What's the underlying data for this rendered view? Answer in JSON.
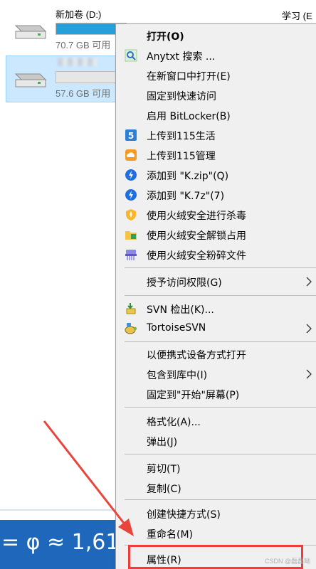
{
  "explorer": {
    "drives": [
      {
        "name": "新加卷 (D:)",
        "free_text": "70.7 GB 可用",
        "usage_fraction": 1.0
      },
      {
        "name": "",
        "free_text": "57.6 GB 可用",
        "usage_fraction": 0.0
      }
    ],
    "right_column_header": "学习 (E"
  },
  "background": {
    "formula_text": "= φ ≈ 1,61"
  },
  "context_menu": {
    "items": [
      {
        "label": "打开(O)",
        "icon": "none",
        "bold": true
      },
      {
        "label": "Anytxt 搜索 ...",
        "icon": "magnifier-icon"
      },
      {
        "label": "在新窗口中打开(E)",
        "icon": "none"
      },
      {
        "label": "固定到快速访问",
        "icon": "none"
      },
      {
        "label": "启用 BitLocker(B)",
        "icon": "none"
      },
      {
        "label": "上传到115生活",
        "icon": "115-life-icon"
      },
      {
        "label": "上传到115管理",
        "icon": "115-cloud-icon"
      },
      {
        "label": "添加到 \"K.zip\"(Q)",
        "icon": "bandizip-icon"
      },
      {
        "label": "添加到 \"K.7z\"(7)",
        "icon": "bandizip-icon"
      },
      {
        "label": "使用火绒安全进行杀毒",
        "icon": "huorong-shield-icon"
      },
      {
        "label": "使用火绒安全解锁占用",
        "icon": "huorong-folder-icon"
      },
      {
        "label": "使用火绒安全粉碎文件",
        "icon": "huorong-shredder-icon"
      },
      {
        "label": "授予访问权限(G)",
        "icon": "none",
        "submenu": true
      },
      {
        "label": "SVN 检出(K)...",
        "icon": "svn-checkout-icon"
      },
      {
        "label": "TortoiseSVN",
        "icon": "tortoise-svn-icon",
        "submenu": true
      },
      {
        "label": "以便携式设备方式打开",
        "icon": "none"
      },
      {
        "label": "包含到库中(I)",
        "icon": "none",
        "submenu": true
      },
      {
        "label": "固定到\"开始\"屏幕(P)",
        "icon": "none"
      },
      {
        "label": "格式化(A)...",
        "icon": "none"
      },
      {
        "label": "弹出(J)",
        "icon": "none"
      },
      {
        "label": "剪切(T)",
        "icon": "none"
      },
      {
        "label": "复制(C)",
        "icon": "none"
      },
      {
        "label": "创建快捷方式(S)",
        "icon": "none"
      },
      {
        "label": "重命名(M)",
        "icon": "none"
      },
      {
        "label": "属性(R)",
        "icon": "none"
      }
    ]
  },
  "annotation": {
    "highlight_color": "#ee3c3c",
    "highlighted_item": "属性(R)",
    "watermark": "CSDN @磊磊呦"
  },
  "colors": {
    "drive_bar_fill": "#26a0da",
    "selection_bg": "#cce8ff",
    "wallpaper_blue": "#1e67ba",
    "menu_bg": "#f0f0f0"
  }
}
